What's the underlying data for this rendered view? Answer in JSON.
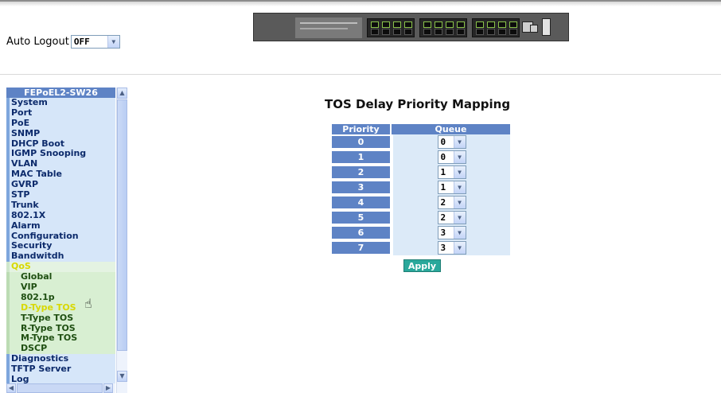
{
  "top": {
    "auto_logout_label": "Auto Logout",
    "auto_logout_value": "OFF"
  },
  "menu": {
    "title": "FEPoEL2-SW26",
    "items": [
      {
        "label": "System",
        "kind": "top"
      },
      {
        "label": "Port",
        "kind": "top"
      },
      {
        "label": "PoE",
        "kind": "top"
      },
      {
        "label": "SNMP",
        "kind": "top"
      },
      {
        "label": "DHCP Boot",
        "kind": "top"
      },
      {
        "label": "IGMP Snooping",
        "kind": "top"
      },
      {
        "label": "VLAN",
        "kind": "top"
      },
      {
        "label": "MAC Table",
        "kind": "top"
      },
      {
        "label": "GVRP",
        "kind": "top"
      },
      {
        "label": "STP",
        "kind": "top"
      },
      {
        "label": "Trunk",
        "kind": "top"
      },
      {
        "label": "802.1X",
        "kind": "top"
      },
      {
        "label": "Alarm",
        "kind": "top"
      },
      {
        "label": "Configuration",
        "kind": "top"
      },
      {
        "label": "Security",
        "kind": "top"
      },
      {
        "label": "Bandwitdh",
        "kind": "top"
      },
      {
        "label": "QoS",
        "kind": "qos"
      },
      {
        "label": "Global",
        "kind": "sub"
      },
      {
        "label": "VIP",
        "kind": "sub"
      },
      {
        "label": "802.1p",
        "kind": "sub"
      },
      {
        "label": "D-Type TOS",
        "kind": "sub-active"
      },
      {
        "label": "T-Type TOS",
        "kind": "sub"
      },
      {
        "label": "R-Type TOS",
        "kind": "sub"
      },
      {
        "label": "M-Type TOS",
        "kind": "sub"
      },
      {
        "label": "DSCP",
        "kind": "sub"
      },
      {
        "label": "Diagnostics",
        "kind": "top"
      },
      {
        "label": "TFTP Server",
        "kind": "top"
      },
      {
        "label": "Log",
        "kind": "top"
      }
    ]
  },
  "main": {
    "title": "TOS Delay Priority Mapping",
    "col_priority": "Priority",
    "col_queue": "Queue",
    "rows": [
      {
        "priority": "0",
        "queue": "0"
      },
      {
        "priority": "1",
        "queue": "0"
      },
      {
        "priority": "2",
        "queue": "1"
      },
      {
        "priority": "3",
        "queue": "1"
      },
      {
        "priority": "4",
        "queue": "2"
      },
      {
        "priority": "5",
        "queue": "2"
      },
      {
        "priority": "6",
        "queue": "3"
      },
      {
        "priority": "7",
        "queue": "3"
      }
    ],
    "apply_label": "Apply"
  },
  "colors": {
    "header_blue": "#5e83c5",
    "menu_bg": "#d6e6f9",
    "qos_sub_bg": "#d8efd2",
    "active_yellow": "#d8d800",
    "apply_teal": "#2aa89b"
  },
  "icons": {
    "dropdown_arrow": "chevron-down-icon",
    "cursor": "hand-pointer-icon"
  }
}
